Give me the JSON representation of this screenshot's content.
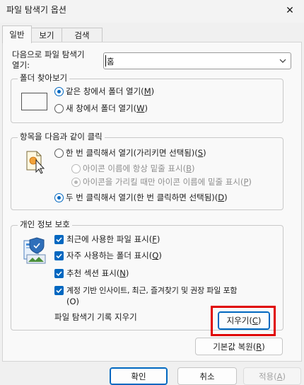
{
  "window": {
    "title": "파일 탐색기 옵션",
    "close_glyph": "✕"
  },
  "tabs": [
    {
      "label": "일반",
      "active": true
    },
    {
      "label": "보기",
      "active": false
    },
    {
      "label": "검색",
      "active": false
    }
  ],
  "general": {
    "open_in_label_1": "다음으로 파일 탐색기",
    "open_in_label_2": "열기:",
    "open_in_value": "홈",
    "browse_folders": {
      "legend": "폴더 찾아보기",
      "same_window": {
        "text": "같은 창에서 폴더 열기(",
        "key": "M",
        "end": ")",
        "selected": true
      },
      "new_window": {
        "text": "새 창에서 폴더 열기(",
        "key": "W",
        "end": ")",
        "selected": false
      }
    },
    "click_items": {
      "legend": "항목을 다음과 같이 클릭",
      "single_click": {
        "text": "한 번 클릭해서 열기(가리키면 선택됨)(",
        "key": "S",
        "end": ")",
        "selected": false
      },
      "underline_always": {
        "text": "아이콘 이름에 항상 밑줄 표시(",
        "key": "B",
        "end": ")",
        "selected": false,
        "disabled": true
      },
      "underline_hover": {
        "text": "아이콘을 가리킬 때만 아이콘 이름에 밑줄 표시(",
        "key": "P",
        "end": ")",
        "selected": true,
        "disabled": true
      },
      "double_click": {
        "text": "두 번 클릭해서 열기(한 번 클릭하면 선택됨)(",
        "key": "D",
        "end": ")",
        "selected": true
      }
    },
    "privacy": {
      "legend": "개인 정보 보호",
      "recent_files": {
        "text": "최근에 사용한 파일 표시(",
        "key": "F",
        "end": ")",
        "checked": true
      },
      "frequent_folders": {
        "text": "자주 사용하는 폴더 표시(",
        "key": "Q",
        "end": ")",
        "checked": true
      },
      "recommended": {
        "text": "추천 섹션 표시(",
        "key": "N",
        "end": ")",
        "checked": true
      },
      "account_based_line1": "계정 기반 인사이트, 최근, 즐겨찾기 및 권장 파일 포함",
      "account_based_line2": "(O)",
      "account_based_checked": true,
      "clear_history_label": "파일 탐색기 기록 지우기",
      "clear_button": {
        "text": "지우기(",
        "key": "C",
        "end": ")"
      }
    },
    "restore_defaults": {
      "text": "기본값 복원(",
      "key": "R",
      "end": ")"
    }
  },
  "footer": {
    "ok": "확인",
    "cancel": "취소",
    "apply": {
      "text": "적용(",
      "key": "A",
      "end": ")",
      "enabled": false
    }
  },
  "colors": {
    "accent": "#0067c0",
    "highlight_box": "#e00000",
    "background": "#f0f0f0",
    "panel": "#f9f9f9"
  }
}
